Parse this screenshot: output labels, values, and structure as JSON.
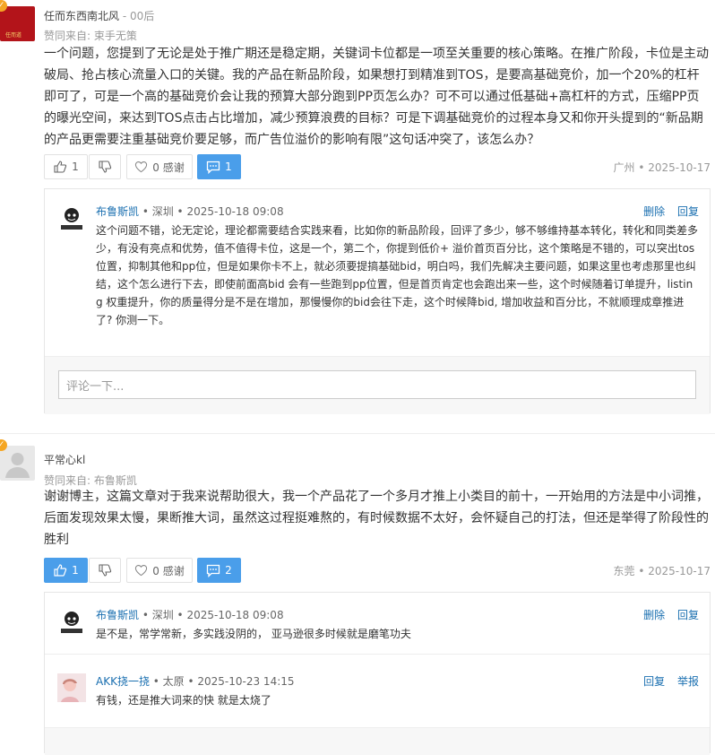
{
  "posts": [
    {
      "username": "任而东西南北风",
      "user_suffix": "- 00后",
      "from": "赞同来自: 束手无策",
      "body": "一个问题，您提到了无论是处于推广期还是稳定期，关键词卡位都是一项至关重要的核心策略。在推广阶段，卡位是主动破局、抢占核心流量入口的关键。我的产品在新品阶段，如果想打到精准到TOS，是要高基础竞价，加一个20%的杠杆即可了，可是一个高的基础竞价会让我的预算大部分跑到PP页怎么办？可不可以通过低基础+高杠杆的方式，压缩PP页的曝光空间，来达到TOS点击占比增加，减少预算浪费的目标？可是下调基础竞价的过程本身又和你开头提到的“新品期的产品更需要注重基础竞价要足够，而广告位溢价的影响有限”这句话冲突了，该怎么办？",
      "like_count": "1",
      "thanks_label": "0 感谢",
      "comment_count": "1",
      "location_date": "广州 • 2025-10-17",
      "avatar_text": "任而道",
      "replies": [
        {
          "name": "布鲁斯凯",
          "meta": "• 深圳 • 2025-10-18 09:08",
          "action1": "删除",
          "action2": "回复",
          "body": "这个问题不错，论无定论，理论都需要结合实践来看，比如你的新品阶段，回评了多少，够不够维持基本转化，转化和同类差多少，有没有亮点和优势，值不值得卡位，这是一个，第二个，你提到低价+ 溢价首页百分比，这个策略是不错的，可以突出tos位置，抑制其他和pp位，但是如果你卡不上，就必须要提搞基础bid，明白吗，我们先解决主要问题，如果这里也考虑那里也纠结，这个怎么进行下去，即使前面高bid 会有一些跑到pp位置，但是首页肯定也会跑出来一些，这个时候随着订单提升，listing 权重提升，你的质量得分是不是在增加，那慢慢你的bid会往下走，这个时候降bid, 增加收益和百分比，不就顺理成章推进了? 你测一下。"
        }
      ],
      "comment_placeholder": "评论一下..."
    },
    {
      "username": "平常心kl",
      "user_suffix": "",
      "from": "赞同来自: 布鲁斯凯",
      "body": "谢谢博主，这篇文章对于我来说帮助很大，我一个产品花了一个多月才推上小类目的前十，一开始用的方法是中小词推，后面发现效果太慢，果断推大词，虽然这过程挺难熬的，有时候数据不太好，会怀疑自己的打法，但还是举得了阶段性的胜利",
      "like_count": "1",
      "thanks_label": "0 感谢",
      "comment_count": "2",
      "location_date": "东莞 • 2025-10-17",
      "replies": [
        {
          "name": "布鲁斯凯",
          "meta": "• 深圳 • 2025-10-18 09:08",
          "action1": "删除",
          "action2": "回复",
          "body": "是不是，常学常新，多实践没阴的， 亚马逊很多时候就是磨笔功夫"
        },
        {
          "name": "AKK挠一挠",
          "meta": "• 太原 • 2025-10-23 14:15",
          "action1": "回复",
          "action2": "举报",
          "body": "有钱，还是推大词来的快 就是太烧了"
        }
      ]
    }
  ],
  "colors": {
    "accent": "#4a9eea",
    "link": "#1a6fb0",
    "badge": "#f5a623"
  }
}
